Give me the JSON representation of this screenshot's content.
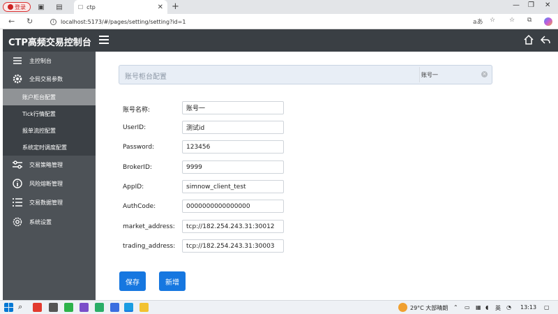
{
  "browser": {
    "login_label": "登录",
    "tab_title": "ctp",
    "url": "localhost:5173/#/pages/setting/setting?id=1",
    "read_aloud": "aあ"
  },
  "app": {
    "title": "CTP高频交易控制台"
  },
  "sidebar": {
    "items": [
      {
        "label": "主控制台",
        "icon": "menu-lines-icon"
      },
      {
        "label": "全局交易参数",
        "icon": "gear-icon"
      },
      {
        "label": "交易策略管理",
        "icon": "sliders-icon"
      },
      {
        "label": "风险熔断管理",
        "icon": "info-circle-icon"
      },
      {
        "label": "交易数据管理",
        "icon": "list-icon"
      },
      {
        "label": "系统设置",
        "icon": "settings-icon"
      }
    ],
    "subitems": [
      {
        "label": "账户柜台配置",
        "active": true
      },
      {
        "label": "Tick行情配置",
        "active": false
      },
      {
        "label": "报单流控配置",
        "active": false
      },
      {
        "label": "系统定时调度配置",
        "active": false
      }
    ]
  },
  "panel": {
    "title": "账号柜台配置",
    "selected_account": "账号一"
  },
  "form": {
    "fields": [
      {
        "label": "账号名称:",
        "value": "账号一"
      },
      {
        "label": "UserID:",
        "value": "测试id"
      },
      {
        "label": "Password:",
        "value": "123456"
      },
      {
        "label": "BrokerID:",
        "value": "9999"
      },
      {
        "label": "AppID:",
        "value": "simnow_client_test"
      },
      {
        "label": "AuthCode:",
        "value": "0000000000000000"
      },
      {
        "label": "market_address:",
        "value": "tcp://182.254.243.31:30012"
      },
      {
        "label": "trading_address:",
        "value": "tcp://182.254.243.31:30003"
      }
    ],
    "save_label": "保存",
    "add_label": "新增"
  },
  "taskbar": {
    "weather": "29°C 大部晴朗",
    "lang": "英",
    "time": "13:13"
  },
  "colors": {
    "header_bg": "#3a3f44",
    "sidebar_bg": "#4d5257",
    "submenu_bg": "#3b4045",
    "active_bg": "#909396",
    "button_bg": "#1677e0"
  }
}
